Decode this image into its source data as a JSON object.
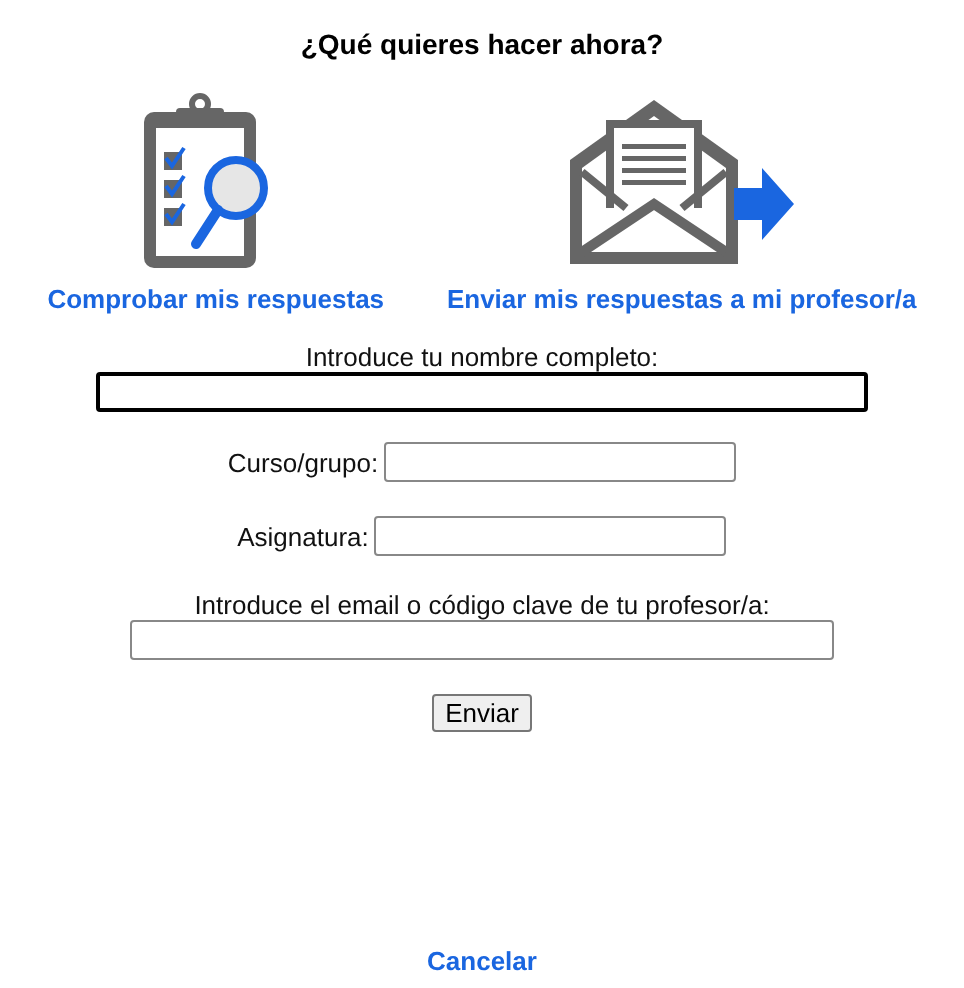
{
  "title": "¿Qué quieres hacer ahora?",
  "options": [
    {
      "kind": "check",
      "label": "Comprobar mis respuestas"
    },
    {
      "kind": "send",
      "label": "Enviar mis respuestas a mi profesor/a"
    }
  ],
  "fields": [
    {
      "kind": "stacked",
      "label": "Introduce tu nombre completo:",
      "focused": true
    },
    {
      "kind": "inline",
      "label": "Curso/grupo:",
      "focused": false
    },
    {
      "kind": "inline",
      "label": "Asignatura:",
      "focused": false
    },
    {
      "kind": "stacked",
      "label": "Introduce el email o código clave de tu profesor/a:",
      "focused": false
    }
  ],
  "submit": "Enviar",
  "cancel": "Cancelar"
}
